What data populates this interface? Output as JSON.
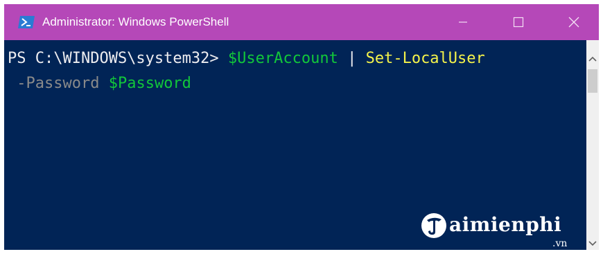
{
  "window": {
    "title": "Administrator: Windows PowerShell",
    "icon": "powershell-icon",
    "controls": [
      "minimize-icon",
      "maximize-icon",
      "close-icon"
    ],
    "colors": {
      "titlebar": "#b548b8",
      "console_bg": "#012456"
    }
  },
  "terminal": {
    "line1": {
      "prompt": "PS C:\\WINDOWS\\system32> ",
      "var": "$UserAccount",
      "pipe": " | ",
      "cmd": "Set-LocalUser"
    },
    "line2": {
      "indent": " ",
      "param": "-Password",
      "space": " ",
      "value": "$Password"
    },
    "colors": {
      "text": "#eeedf0",
      "variable": "#12c73a",
      "command": "#f5f34a",
      "parameter": "#8a8a8a"
    }
  },
  "watermark": {
    "brand": "aimienphi",
    "suffix": ".vn"
  }
}
